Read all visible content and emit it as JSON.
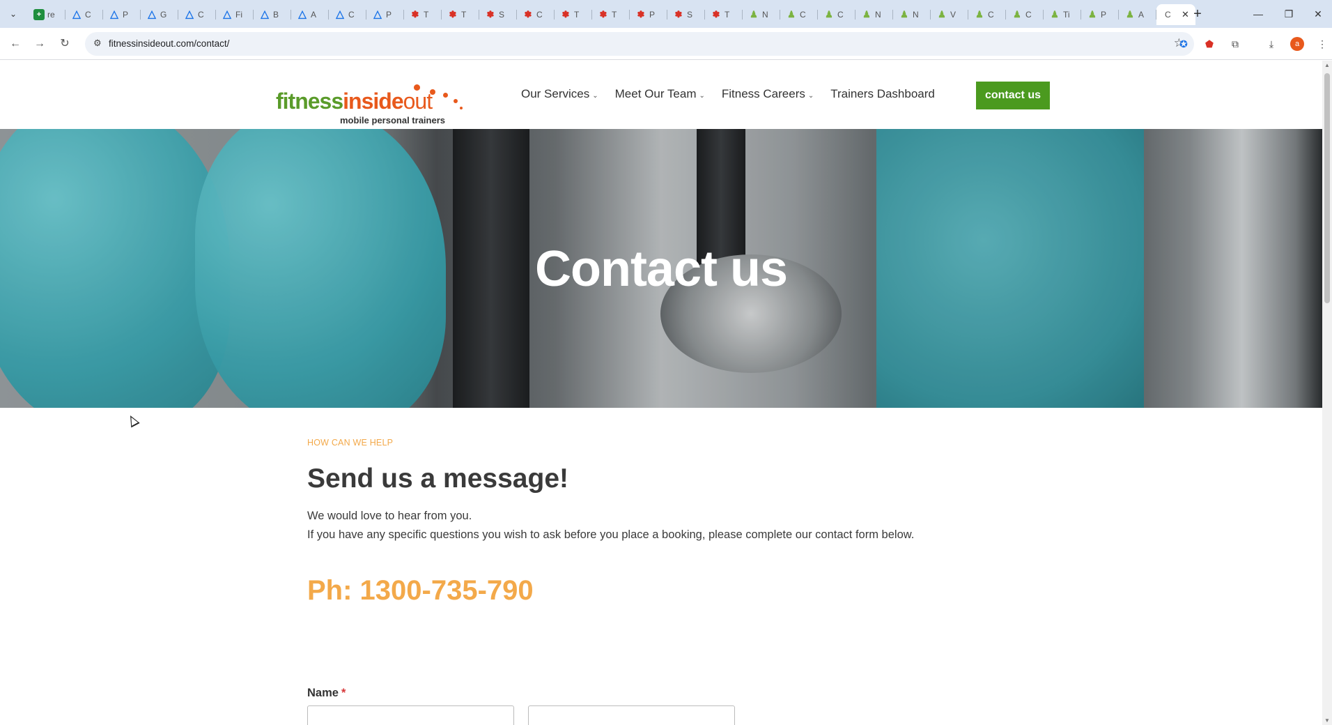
{
  "browser": {
    "tabs": [
      {
        "icon": "sheets-icon",
        "glyph": "+",
        "kind": "sheet",
        "letter": "re"
      },
      {
        "icon": "tri-icon",
        "glyph": "△",
        "kind": "tri",
        "letter": "C"
      },
      {
        "icon": "tri-icon",
        "glyph": "△",
        "kind": "tri",
        "letter": "P"
      },
      {
        "icon": "tri-icon",
        "glyph": "△",
        "kind": "tri",
        "letter": "G"
      },
      {
        "icon": "tri-icon",
        "glyph": "△",
        "kind": "tri",
        "letter": "C"
      },
      {
        "icon": "tri-icon",
        "glyph": "△",
        "kind": "tri",
        "letter": "Fi"
      },
      {
        "icon": "tri-icon",
        "glyph": "△",
        "kind": "tri",
        "letter": "B"
      },
      {
        "icon": "tri-icon",
        "glyph": "△",
        "kind": "tri",
        "letter": "A"
      },
      {
        "icon": "tri-icon",
        "glyph": "△",
        "kind": "tri",
        "letter": "C"
      },
      {
        "icon": "tri-icon",
        "glyph": "△",
        "kind": "tri",
        "letter": "P"
      },
      {
        "icon": "red-logo-icon",
        "glyph": "✽",
        "kind": "red",
        "letter": "T"
      },
      {
        "icon": "red-logo-icon",
        "glyph": "✽",
        "kind": "red",
        "letter": "T"
      },
      {
        "icon": "red-logo-icon",
        "glyph": "✽",
        "kind": "red",
        "letter": "S"
      },
      {
        "icon": "red-logo-icon",
        "glyph": "✽",
        "kind": "red",
        "letter": "C"
      },
      {
        "icon": "red-logo-icon",
        "glyph": "✽",
        "kind": "red",
        "letter": "T"
      },
      {
        "icon": "red-logo-icon",
        "glyph": "✽",
        "kind": "red",
        "letter": "T"
      },
      {
        "icon": "red-logo-icon",
        "glyph": "✽",
        "kind": "red",
        "letter": "P"
      },
      {
        "icon": "red-logo-icon",
        "glyph": "✽",
        "kind": "red",
        "letter": "S"
      },
      {
        "icon": "red-logo-icon",
        "glyph": "✽",
        "kind": "red",
        "letter": "T"
      },
      {
        "icon": "figure-icon",
        "glyph": "♟",
        "kind": "green",
        "letter": "N"
      },
      {
        "icon": "figure-icon",
        "glyph": "♟",
        "kind": "green",
        "letter": "C"
      },
      {
        "icon": "figure-icon",
        "glyph": "♟",
        "kind": "green",
        "letter": "C"
      },
      {
        "icon": "figure-icon",
        "glyph": "♟",
        "kind": "green",
        "letter": "N"
      },
      {
        "icon": "figure-icon",
        "glyph": "♟",
        "kind": "green",
        "letter": "N"
      },
      {
        "icon": "figure-icon",
        "glyph": "♟",
        "kind": "green",
        "letter": "V"
      },
      {
        "icon": "figure-icon",
        "glyph": "♟",
        "kind": "green",
        "letter": "C"
      },
      {
        "icon": "figure-icon",
        "glyph": "♟",
        "kind": "green",
        "letter": "C"
      },
      {
        "icon": "figure-icon",
        "glyph": "♟",
        "kind": "green",
        "letter": "Ti"
      },
      {
        "icon": "figure-icon",
        "glyph": "♟",
        "kind": "green",
        "letter": "P"
      },
      {
        "icon": "figure-icon",
        "glyph": "♟",
        "kind": "green",
        "letter": "A"
      }
    ],
    "active_tab": {
      "letter": "C",
      "close": "✕"
    },
    "new_tab": "+",
    "url": "fitnessinsideout.com/contact/",
    "avatar_letter": "a",
    "colors": {
      "tabbar": "#d8e3f2",
      "omnibox": "#eef2f8"
    }
  },
  "site": {
    "logo": {
      "fitness": "fitness",
      "inside": "inside",
      "out": "out",
      "tagline": "mobile personal trainers"
    },
    "nav": [
      {
        "label": "Our Services",
        "has_caret": true
      },
      {
        "label": "Meet Our Team",
        "has_caret": true
      },
      {
        "label": "Fitness Careers",
        "has_caret": true
      },
      {
        "label": "Trainers Dashboard",
        "has_caret": false
      }
    ],
    "caret": "⌄",
    "cta": "contact us",
    "colors": {
      "brand_green": "#4b9a1f",
      "brand_orange": "#e8591c",
      "accent": "#f3a94a"
    }
  },
  "hero": {
    "title": "Contact us"
  },
  "content": {
    "eyebrow": "HOW CAN WE HELP",
    "title": "Send us a message!",
    "intro_line1": "We would love to hear from you.",
    "intro_line2": "If you have any specific questions you wish to ask before you place a booking, please complete our contact form below.",
    "phone": "Ph: 1300-735-790",
    "form": {
      "name_label": "Name",
      "required_mark": "*",
      "first_value": "",
      "last_value": ""
    }
  }
}
